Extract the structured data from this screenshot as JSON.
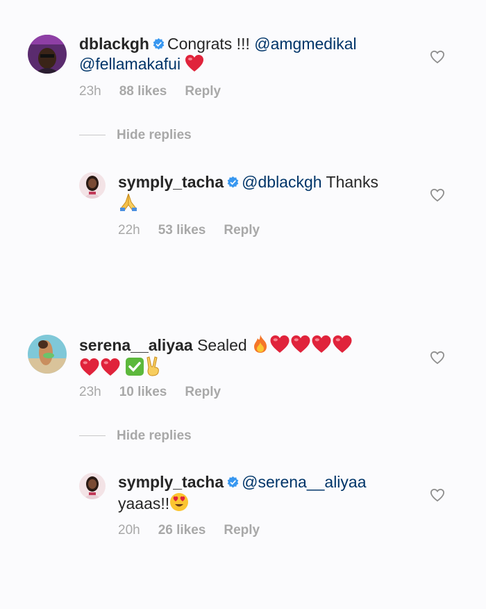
{
  "comments": [
    {
      "username": "dblackgh",
      "text_prefix": "Congrats !!!",
      "mention1": "@amgmedikal",
      "mention2": "@fellamakafui",
      "time": "23h",
      "likes": "88 likes",
      "reply": "Reply",
      "hide_replies": "Hide replies",
      "reply_item": {
        "username": "symply_tacha",
        "mention": "@dblackgh",
        "text": "Thanks",
        "time": "22h",
        "likes": "53 likes",
        "reply": "Reply"
      }
    },
    {
      "username": "serena__aliyaa",
      "text": "Sealed",
      "time": "23h",
      "likes": "10 likes",
      "reply": "Reply",
      "hide_replies": "Hide replies",
      "reply_item": {
        "username": "symply_tacha",
        "mention": "@serena__aliyaa",
        "text": "yaaas!!",
        "time": "20h",
        "likes": "26 likes",
        "reply": "Reply"
      }
    }
  ],
  "colors": {
    "text": "#262626",
    "mention": "#003569",
    "meta": "#a8a8a8",
    "verified": "#3897f0",
    "heart_emoji": "#e0233b"
  }
}
